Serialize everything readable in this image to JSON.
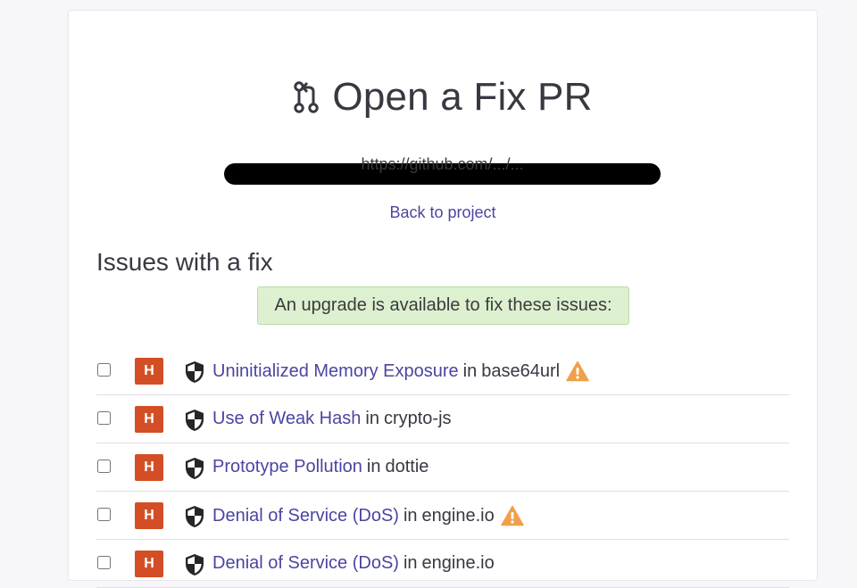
{
  "page": {
    "title": "Open a Fix PR",
    "redacted_url": "https://github.com/.../...",
    "back_link": "Back to project",
    "section_heading": "Issues with a fix",
    "notice": "An upgrade is available to fix these issues:"
  },
  "colors": {
    "link": "#4b45a1",
    "severity_high": "#d44e25",
    "notice_bg": "#ddf0d0",
    "warning": "#f0a04b"
  },
  "issues": [
    {
      "severity": "H",
      "title": "Uninitialized Memory Exposure",
      "in": "in",
      "package": "base64url",
      "warning": true
    },
    {
      "severity": "H",
      "title": "Use of Weak Hash",
      "in": "in",
      "package": "crypto-js",
      "warning": false
    },
    {
      "severity": "H",
      "title": "Prototype Pollution",
      "in": "in",
      "package": "dottie",
      "warning": false
    },
    {
      "severity": "H",
      "title": "Denial of Service (DoS)",
      "in": "in",
      "package": "engine.io",
      "warning": true
    },
    {
      "severity": "H",
      "title": "Denial of Service (DoS)",
      "in": "in",
      "package": "engine.io",
      "warning": false
    }
  ]
}
